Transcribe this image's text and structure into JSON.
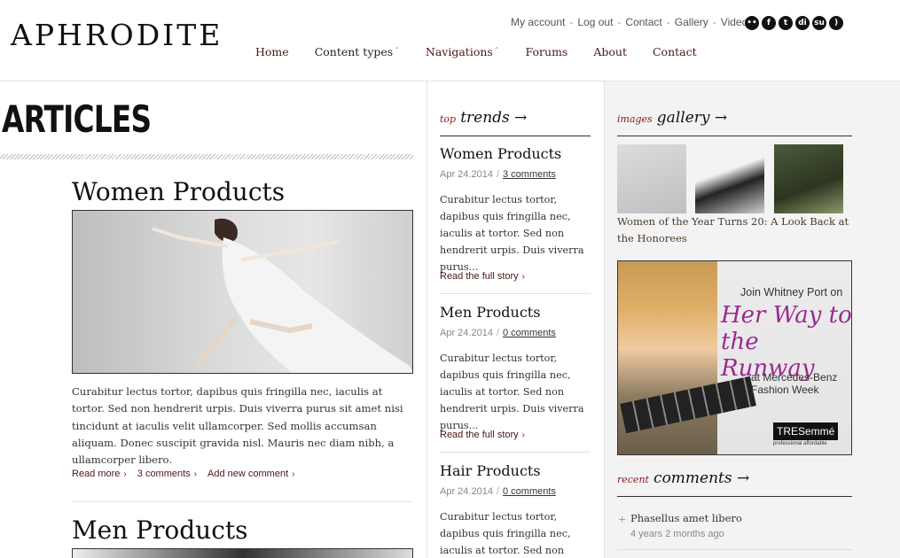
{
  "site": {
    "logo": "APHRODITE"
  },
  "topnav": {
    "my_account": "My account",
    "log_out": "Log out",
    "contact": "Contact",
    "gallery": "Gallery",
    "video": "Video",
    "sep": "-"
  },
  "social": [
    {
      "icon": "flickr-icon",
      "glyph": "••"
    },
    {
      "icon": "facebook-icon",
      "glyph": "f"
    },
    {
      "icon": "twitter-icon",
      "glyph": "t"
    },
    {
      "icon": "digg-icon",
      "glyph": "di"
    },
    {
      "icon": "stumbleupon-icon",
      "glyph": "su"
    },
    {
      "icon": "rss-icon",
      "glyph": ")"
    }
  ],
  "mainnav": {
    "home": "Home",
    "content_types": "Content types",
    "navigations": "Navigations",
    "forums": "Forums",
    "about": "About",
    "contact": "Contact"
  },
  "articles": {
    "title": "ARTICLES",
    "first": {
      "title": "Women Products",
      "body": "Curabitur lectus tortor, dapibus quis fringilla nec, iaculis at tortor. Sed non hendrerit urpis. Duis viverra purus sit amet nisi tincidunt at iaculis velit ullamcorper. Sed mollis accumsan aliquam. Donec suscipit gravida nisl. Mauris nec diam nibh, a ullamcorper libero.",
      "read_more": "Read more",
      "comments": "3 comments",
      "add_comment": "Add new comment"
    },
    "second": {
      "title": "Men Products"
    }
  },
  "trends": {
    "small": "top",
    "big": "trends →",
    "items": [
      {
        "title": "Women Products",
        "date": "Apr 24.2014",
        "comments": "3 comments",
        "body": "Curabitur lectus tortor, dapibus quis fringilla nec, iaculis at tortor. Sed non hendrerit urpis. Duis viverra purus...",
        "read": "Read the full story"
      },
      {
        "title": "Men Products",
        "date": "Apr 24.2014",
        "comments": "0 comments",
        "body": "Curabitur lectus tortor, dapibus quis fringilla nec, iaculis at tortor. Sed non hendrerit urpis. Duis viverra purus...",
        "read": "Read the full story"
      },
      {
        "title": "Hair Products",
        "date": "Apr 24.2014",
        "comments": "0 comments",
        "body": "Curabitur lectus tortor, dapibus quis fringilla nec, iaculis at tortor. Sed non hendrerit urpis."
      }
    ]
  },
  "gallery": {
    "small": "images",
    "big": "gallery →",
    "caption": "Women of the Year Turns 20: A Look Back at the Honorees"
  },
  "ad": {
    "join": "Join Whitney Port on",
    "slogan": "Her Way to the Runway",
    "sub": "at Mercedes-Benz Fashion Week",
    "brand": "TRESemmé",
    "brand_sub": "professional   affordable"
  },
  "recent": {
    "small": "recent",
    "big": "comments →",
    "items": [
      {
        "text": "Phasellus amet libero",
        "time": "4 years 2 months ago"
      }
    ]
  }
}
